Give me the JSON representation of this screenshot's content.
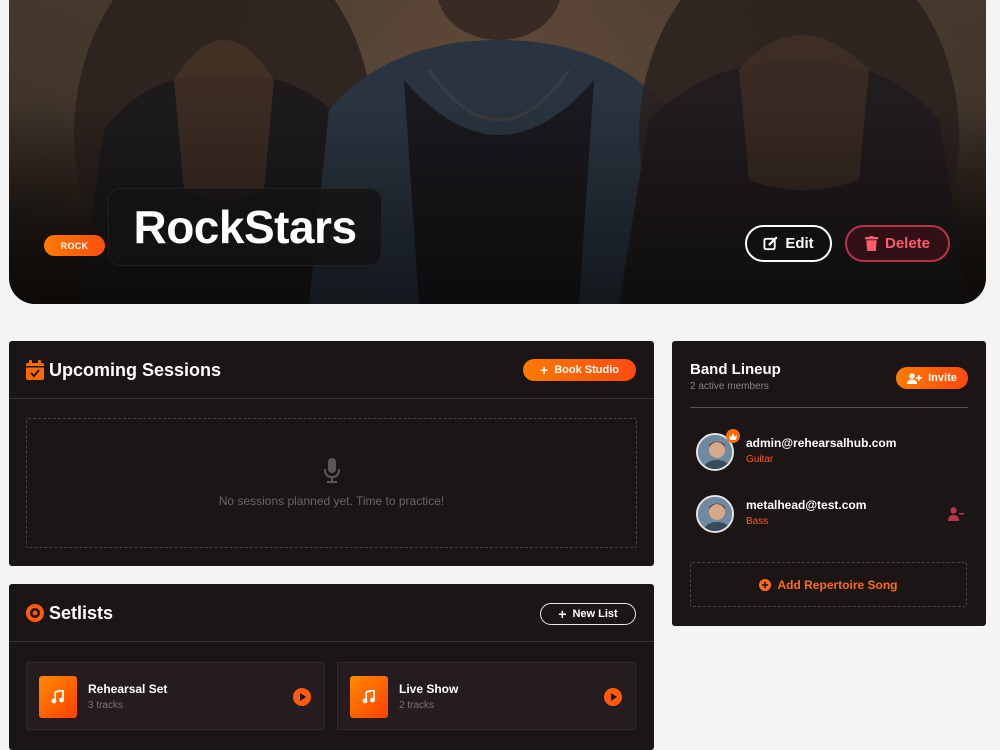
{
  "hero": {
    "genre": "ROCK",
    "band_name": "RockStars",
    "edit_label": "Edit",
    "delete_label": "Delete"
  },
  "sessions": {
    "title": "Upcoming Sessions",
    "book_label": "Book Studio",
    "empty_text": "No sessions planned yet. Time to practice!"
  },
  "setlists": {
    "title": "Setlists",
    "new_label": "New List",
    "items": [
      {
        "name": "Rehearsal Set",
        "count": "3 tracks"
      },
      {
        "name": "Live Show",
        "count": "2 tracks"
      }
    ]
  },
  "lineup": {
    "title": "Band Lineup",
    "subtitle": "2 active members",
    "invite_label": "Invite",
    "members": [
      {
        "email": "admin@rehearsalhub.com",
        "role": "Guitar",
        "is_admin": true
      },
      {
        "email": "metalhead@test.com",
        "role": "Bass",
        "is_admin": false
      }
    ],
    "add_song_label": "Add Repertoire Song"
  },
  "colors": {
    "accent": "#ff5a1e",
    "accent_gradient_start": "#ff7a00",
    "accent_gradient_end": "#ff4a10",
    "danger": "#ff5a6e",
    "card_bg": "#1c1516",
    "page_bg": "#f4f4f4"
  },
  "icons": {
    "edit": "edit-icon",
    "delete": "trash-icon",
    "calendar": "calendar-icon",
    "microphone": "microphone-icon",
    "setlist": "record-icon",
    "music": "music-note-icon",
    "play": "play-icon",
    "invite": "user-plus-icon",
    "remove": "user-minus-icon",
    "crown": "crown-icon"
  }
}
